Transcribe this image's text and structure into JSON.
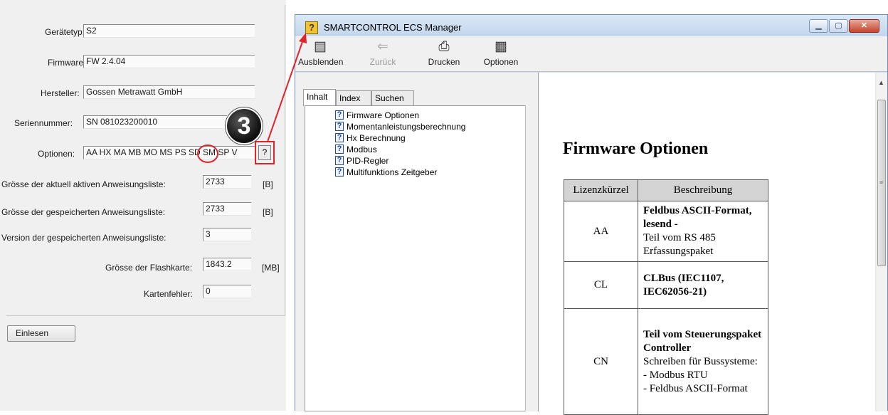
{
  "device": {
    "type_label": "Gerätetyp:",
    "type_value": "S2",
    "firmware_label": "Firmware:",
    "firmware_value": "FW 2.4.04",
    "manufacturer_label": "Hersteller:",
    "manufacturer_value": "Gossen Metrawatt GmbH",
    "serial_label": "Seriennummer:",
    "serial_value": "SN 081023200010",
    "options_label": "Optionen:",
    "options_value": "AA HX MA MB MO MS PS SD SM SP V",
    "options_help_label": "?",
    "active_list_label": "Grösse der aktuell aktiven  Anweisungsliste:",
    "active_list_value": "2733",
    "active_list_unit": "[B]",
    "stored_list_label": "Grösse der gespeicherten  Anweisungsliste:",
    "stored_list_value": "2733",
    "stored_list_unit": "[B]",
    "stored_version_label": "Version der gespeicherten  Anweisungsliste:",
    "stored_version_value": "3",
    "flash_label": "Grösse der Flashkarte:",
    "flash_value": "1843.2",
    "flash_unit": "[MB]",
    "card_error_label": "Kartenfehler:",
    "card_error_value": "0",
    "read_button": "Einlesen"
  },
  "annotation": {
    "step_number": "3",
    "accent_color": "#e0242a"
  },
  "help_window": {
    "title": "SMARTCONTROL ECS Manager",
    "controls": {
      "minimize": "▁",
      "maximize": "▢",
      "close": "✕"
    },
    "toolbar": [
      {
        "id": "hide",
        "label": "Ausblenden",
        "icon": "hide-icon",
        "enabled": true
      },
      {
        "id": "back",
        "label": "Zurück",
        "icon": "back-arrow-icon",
        "enabled": false
      },
      {
        "id": "print",
        "label": "Drucken",
        "icon": "printer-icon",
        "enabled": true
      },
      {
        "id": "options",
        "label": "Optionen",
        "icon": "options-icon",
        "enabled": true
      }
    ],
    "tabs": [
      "Inhalt",
      "Index",
      "Suchen"
    ],
    "toc": [
      "Firmware Optionen",
      "Momentanleistungsberechnung",
      "Hx Berechnung",
      "Modbus",
      "PID-Regler",
      "Multifunktions Zeitgeber"
    ],
    "content": {
      "title": "Firmware Optionen",
      "table_headers": [
        "Lizenzkürzel",
        "Beschreibung"
      ],
      "rows": [
        {
          "code": "AA",
          "desc_bold": "Feldbus ASCII-Format, lesend -",
          "desc_lines": [
            "Teil vom RS 485 Erfassungspaket"
          ]
        },
        {
          "code": "CL",
          "desc_bold": "CLBus (IEC1107, IEC62056-21)",
          "desc_lines": []
        },
        {
          "code": "CN",
          "desc_bold": "Teil vom Steuerungspaket Controller",
          "desc_lines": [
            "Schreiben für Bussysteme:",
            "- Modbus RTU",
            "- Feldbus ASCII-Format"
          ]
        }
      ]
    }
  }
}
